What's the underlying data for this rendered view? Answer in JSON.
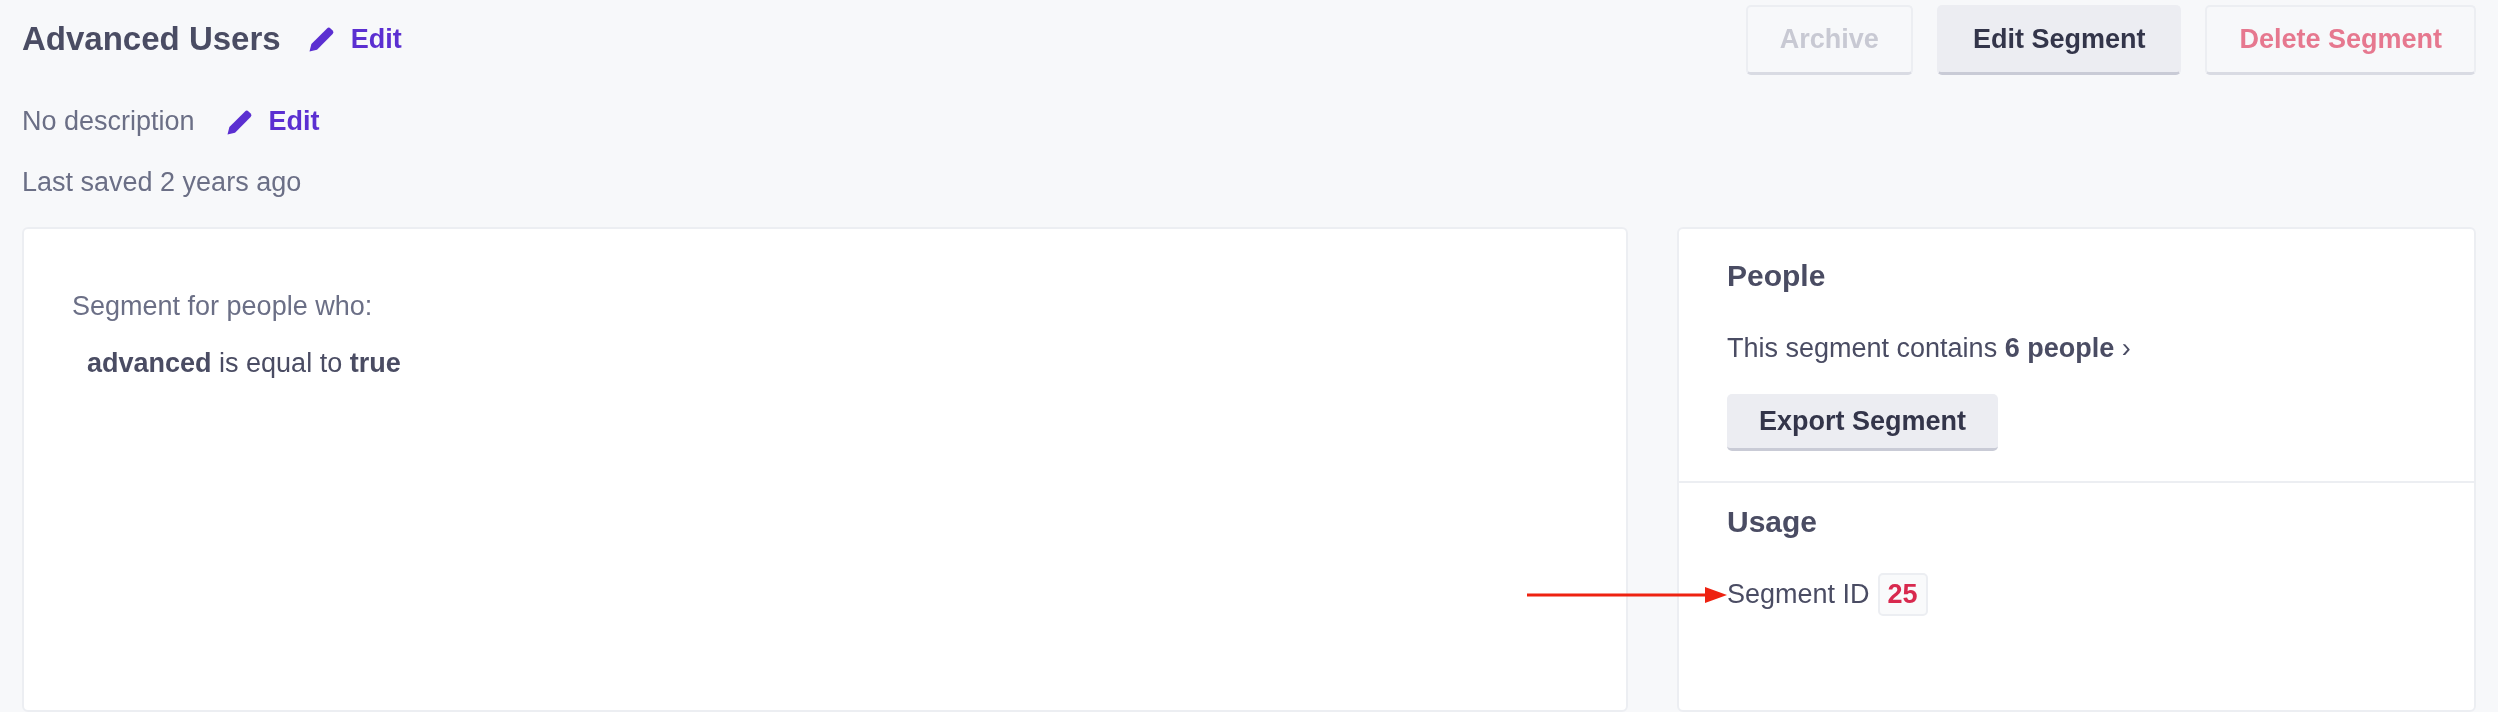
{
  "header": {
    "title": "Advanced Users",
    "title_edit": "Edit",
    "description": "No description",
    "description_edit": "Edit",
    "last_saved": "Last saved 2 years ago"
  },
  "actions": [
    {
      "label": "Archive",
      "kind": "plain",
      "disabled": true
    },
    {
      "label": "Edit Segment",
      "kind": "primary",
      "disabled": false
    },
    {
      "label": "Delete Segment",
      "kind": "danger",
      "disabled": false
    }
  ],
  "definition": {
    "intro": "Segment for people who:",
    "rule": "**advanced** is equal to **true**"
  },
  "people": {
    "heading": "People",
    "summary": "This segment contains **6 people** ›",
    "export_button": "Export Segment"
  },
  "usage": {
    "heading": "Usage",
    "id_label": "Segment ID",
    "id_value": "25"
  }
}
